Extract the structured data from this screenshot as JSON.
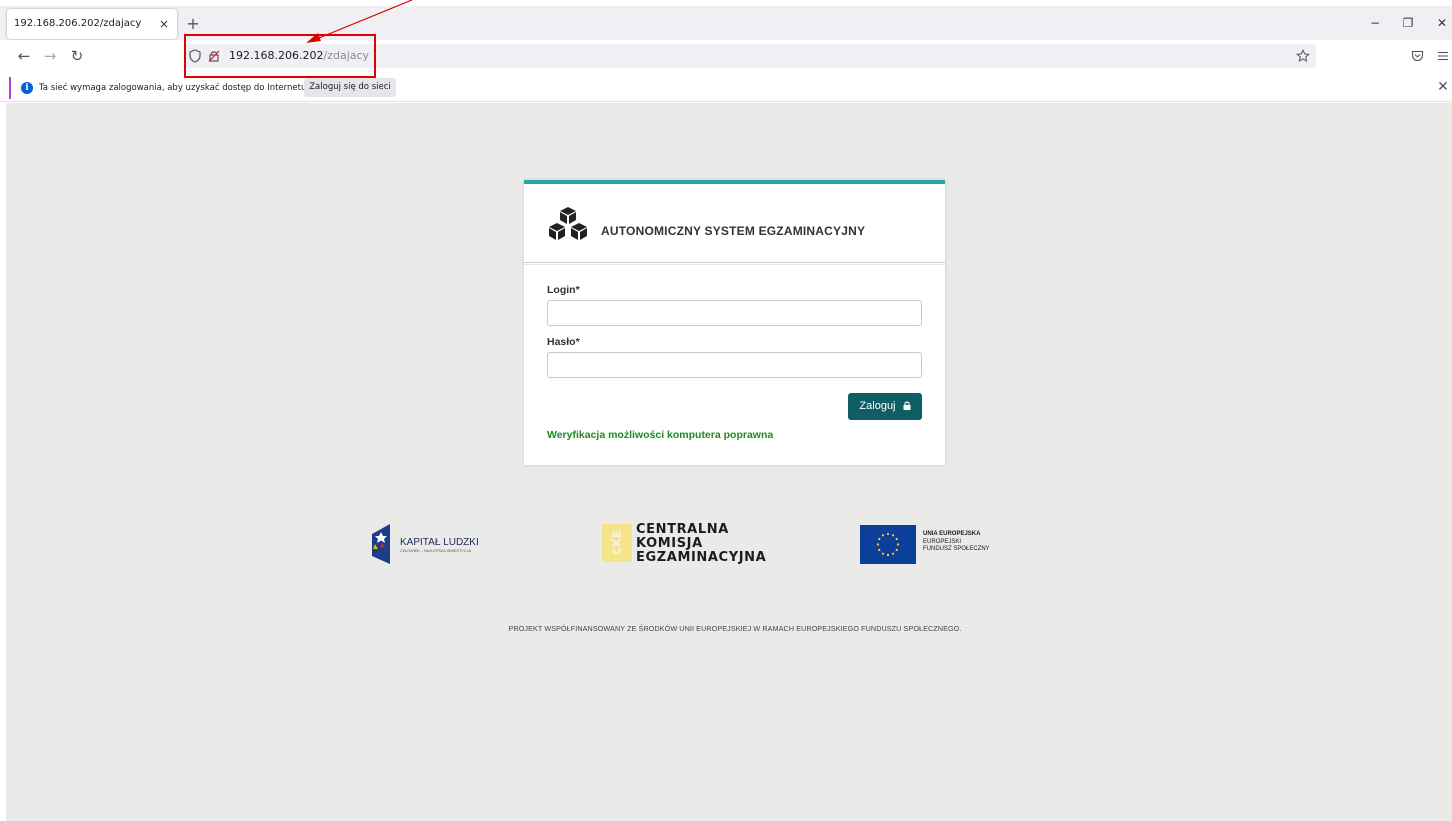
{
  "browser": {
    "tab_title": "192.168.206.202/zdajacy",
    "tab_close": "×",
    "new_tab": "+",
    "window_controls": {
      "minimize": "−",
      "restore": "❐",
      "close": "✕"
    },
    "nav": {
      "back": "←",
      "forward": "→",
      "reload": "↻"
    },
    "url_host": "192.168.206.202",
    "url_path": "/zdajacy",
    "notification": {
      "text": "Ta sieć wymaga zalogowania, aby uzyskać dostęp do Internetu.",
      "button": "Zaloguj się do sieci",
      "close": "✕"
    },
    "icons": [
      "shield-icon",
      "insecure-lock-icon",
      "bookmark-star-icon",
      "pocket-icon",
      "menu-icon",
      "info-icon"
    ]
  },
  "login": {
    "title": "AUTONOMICZNY SYSTEM EGZAMINACYJNY",
    "login_label": "Login*",
    "login_value": "",
    "password_label": "Hasło*",
    "password_value": "",
    "submit_label": "Zaloguj",
    "verification_text": "Weryfikacja możliwości komputera poprawna",
    "accent_color": "#2aa6a6",
    "button_color": "#0f5e66",
    "verification_color": "#1f8a1f"
  },
  "logos": {
    "kapital_ludzki": {
      "title": "KAPITAŁ LUDZKI",
      "subtitle": "CZŁOWIEK – NAJLEPSZA INWESTYCJA"
    },
    "cke": {
      "mark": "CKE",
      "lines": [
        "CENTRALNA",
        "KOMISJA",
        "EGZAMINACYJNA"
      ]
    },
    "eu": {
      "lines": [
        "UNIA EUROPEJSKA",
        "EUROPEJSKI",
        "FUNDUSZ SPOŁECZNY"
      ]
    }
  },
  "footer": "PROJEKT WSPÓŁFINANSOWANY ZE ŚRODKÓW UNII EUROPEJSKIEJ W RAMACH EUROPEJSKIEGO FUNDUSZU SPOŁECZNEGO."
}
